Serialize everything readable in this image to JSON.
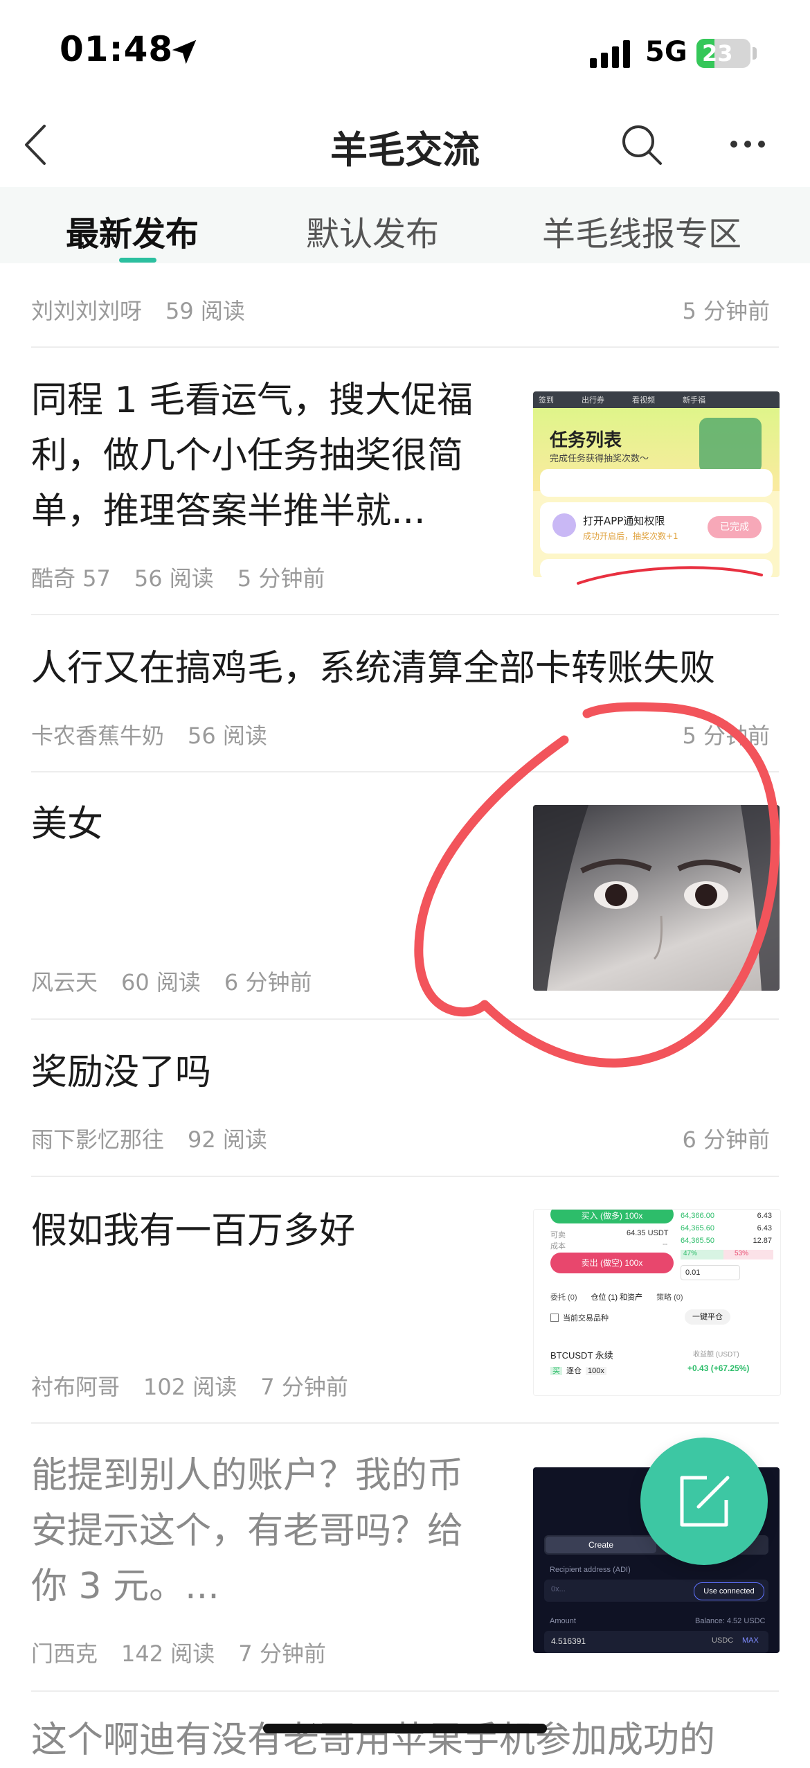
{
  "status": {
    "time": "01:48",
    "network": "5G",
    "battery": "23"
  },
  "nav": {
    "title": "羊毛交流"
  },
  "tabs": [
    {
      "label": "最新发布",
      "active": true
    },
    {
      "label": "默认发布",
      "active": false
    },
    {
      "label": "羊毛线报专区",
      "active": false
    }
  ],
  "posts": [
    {
      "title": "",
      "author": "刘刘刘刘呀",
      "reads": "59 阅读",
      "time": "5 分钟前"
    },
    {
      "title_lines": [
        "同程 1 毛看运气，搜大促福",
        "利，做几个小任务抽奖很简",
        "单，推理答案半推半就..."
      ],
      "author": "酷奇 57",
      "reads": "56 阅读",
      "time": "5 分钟前",
      "thumb": {
        "heading": "任务列表",
        "sub": "完成任务获得抽奖次数～",
        "item1": "打开APP通知权限",
        "item1_sub": "成功开启后，抽奖次数+1",
        "item1_btn": "已完成",
        "top_tabs": [
          "签到",
          "出行券",
          "看视频",
          "新手福"
        ]
      }
    },
    {
      "title": "人行又在搞鸡毛，系统清算全部卡转账失败",
      "author": "卡农香蕉牛奶",
      "reads": "56 阅读",
      "time": "5 分钟前"
    },
    {
      "title": "美女",
      "author": "风云天",
      "reads": "60 阅读",
      "time": "6 分钟前"
    },
    {
      "title": "奖励没了吗",
      "author": "雨下影忆那往",
      "reads": "92 阅读",
      "time": "6 分钟前"
    },
    {
      "title": "假如我有一百万多好",
      "author": "衬布阿哥",
      "reads": "102 阅读",
      "time": "7 分钟前",
      "thumb": {
        "buy": "买入 (做多) 100x",
        "sell": "卖出 (做空) 100x",
        "avail_label": "可卖",
        "avail_val": "64.35 USDT",
        "cost_label": "成本",
        "cost_val": "--",
        "prices": [
          "64,366.00",
          "64,365.60",
          "64,365.50"
        ],
        "sizes": [
          "6.43",
          "6.43",
          "12.87"
        ],
        "pct_buy": "47%",
        "pct_sell": "53%",
        "step": "0.01",
        "tabs": [
          "委托 (0)",
          "仓位 (1) 和资产",
          "策略 (0)"
        ],
        "filter": "当前交易品种",
        "close_all": "一键平仓",
        "symbol": "BTCUSDT 永续",
        "pnl_label": "收益额 (USDT)",
        "pnl": "+0.43 (+67.25%)",
        "tag1": "买",
        "tag2": "逐仓",
        "tag3": "100x"
      }
    },
    {
      "title_lines": [
        "能提到别人的账户？我的币",
        "安提示这个，有老哥吗？给",
        "你 3 元。..."
      ],
      "author": "门西克",
      "reads": "142 阅读",
      "time": "7 分钟前",
      "thumb": {
        "create": "Create",
        "recipient": "Recipient address (ADI)",
        "placeholder": "0x...",
        "use_connected": "Use connected",
        "amount": "Amount",
        "balance": "Balance: 4.52 USDC",
        "amount_val": "4.516391",
        "unit": "USDC",
        "max": "MAX"
      }
    },
    {
      "title": "这个啊迪有没有老哥用苹果手机参加成功的"
    }
  ]
}
